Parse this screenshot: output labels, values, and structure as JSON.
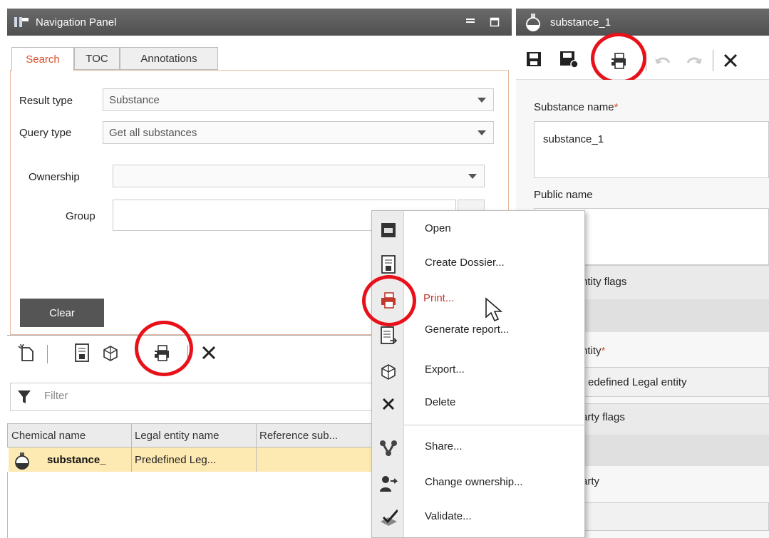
{
  "nav_panel": {
    "title": "Navigation Panel",
    "tabs": [
      {
        "label": "Search",
        "active": true
      },
      {
        "label": "TOC",
        "active": false
      },
      {
        "label": "Annotations",
        "active": false
      }
    ],
    "result_type": {
      "label": "Result type",
      "value": "Substance"
    },
    "query_type": {
      "label": "Query type",
      "value": "Get all substances"
    },
    "ownership": {
      "label": "Ownership",
      "value": ""
    },
    "group": {
      "label": "Group",
      "value": ""
    },
    "clear_label": "Clear",
    "filter_placeholder": "Filter",
    "table": {
      "columns": [
        "Chemical name",
        "Legal entity name",
        "Reference sub..."
      ],
      "rows": [
        {
          "chemical_name": "substance_",
          "legal_entity": "Predefined Leg...",
          "reference": ""
        }
      ]
    }
  },
  "substance_panel": {
    "title": "substance_1",
    "substance_name_label": "Substance name",
    "required_mark": "*",
    "substance_name_value": "substance_1",
    "public_name_label": "Public name",
    "partial_labels": [
      "ntity flags",
      "ntity",
      "edefined Legal entity",
      "arty flags",
      "arty"
    ]
  },
  "context_menu": {
    "items": [
      {
        "label": "Open",
        "icon": "open-icon"
      },
      {
        "label": "Create Dossier...",
        "icon": "dossier-icon"
      },
      {
        "label": "Print...",
        "icon": "print-icon",
        "highlighted": true
      },
      {
        "label": "Generate report...",
        "icon": "report-icon"
      },
      {
        "label": "Export...",
        "icon": "export-icon"
      },
      {
        "label": "Delete",
        "icon": "delete-icon"
      },
      {
        "label": "Share...",
        "icon": "share-icon"
      },
      {
        "label": "Change ownership...",
        "icon": "change-ownership-icon"
      },
      {
        "label": "Validate...",
        "icon": "validate-icon"
      }
    ]
  },
  "colors": {
    "accent": "#d9522e",
    "highlight_row": "#fde9b2",
    "annotation_circle": "#e8111a",
    "titlebar": "#5c5c5c"
  }
}
